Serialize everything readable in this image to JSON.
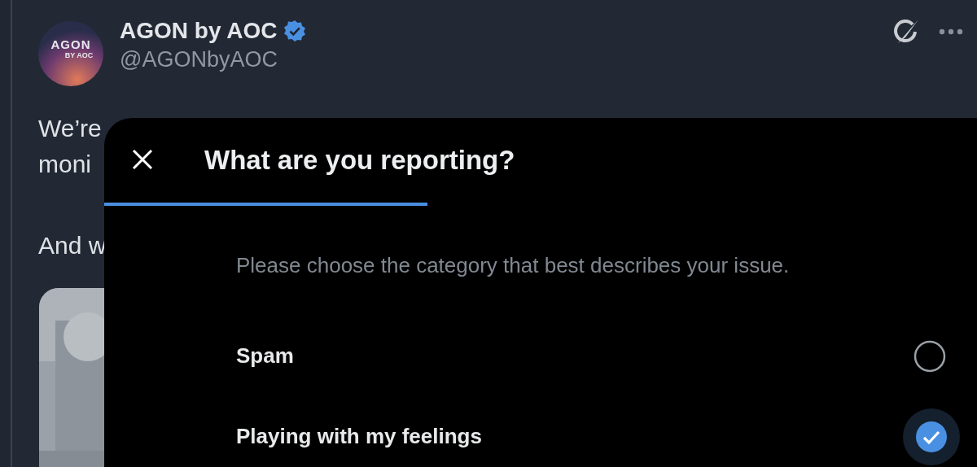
{
  "tweet": {
    "avatar": {
      "logo_top": "AGON",
      "logo_bottom": "BY AOC"
    },
    "name": "AGON by AOC",
    "verified": true,
    "handle": "@AGONbyAOC",
    "lines": [
      "We’re",
      "moni",
      "And w"
    ]
  },
  "dialog": {
    "title": "What are you reporting?",
    "progress": {
      "level": 0.37
    },
    "prompt": "Please choose the category that best describes your issue.",
    "options": [
      {
        "label": "Spam",
        "selected": false
      },
      {
        "label": "Playing with my feelings",
        "selected": true
      }
    ]
  }
}
